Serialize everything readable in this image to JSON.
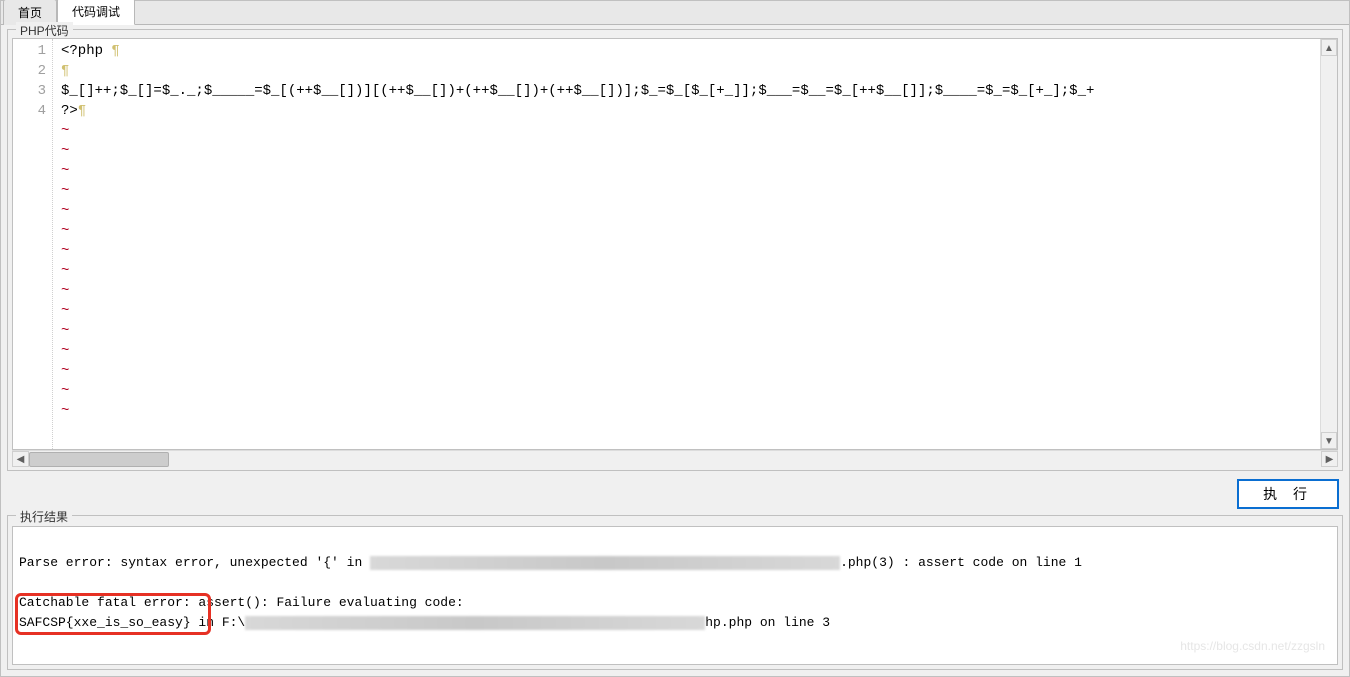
{
  "tabs": {
    "home": "首页",
    "debug": "代码调试"
  },
  "code_section": {
    "legend": "PHP代码",
    "gutter": [
      "1",
      "2",
      "3",
      "4"
    ],
    "lines": {
      "l1": "<?php",
      "l1_ws": "¶",
      "l2_ws": "¶",
      "l3": "$_[]++;$_[]=$_._;$_____=$_[(++$__[])][(++$__[])+(++$__[])+(++$__[])];$_=$_[$_[+_]];$___=$__=$_[++$__[]];$____=$_=$_[+_];$_+",
      "l4": "?>",
      "l4_ws": "¶",
      "tilde": "~"
    }
  },
  "run_button": "执 行",
  "result_section": {
    "legend": "执行结果",
    "line1_a": "Parse error: syntax error, unexpected '{' in ",
    "line1_b": ".php(3) : assert code on line 1",
    "line2": "Catchable fatal error: assert(): Failure evaluating code:",
    "line3_a": "SAFCSP{xxe_is_so_easy} in F:\\",
    "line3_b": "hp.php on line 3"
  },
  "watermark": "https://blog.csdn.net/zzgsln"
}
